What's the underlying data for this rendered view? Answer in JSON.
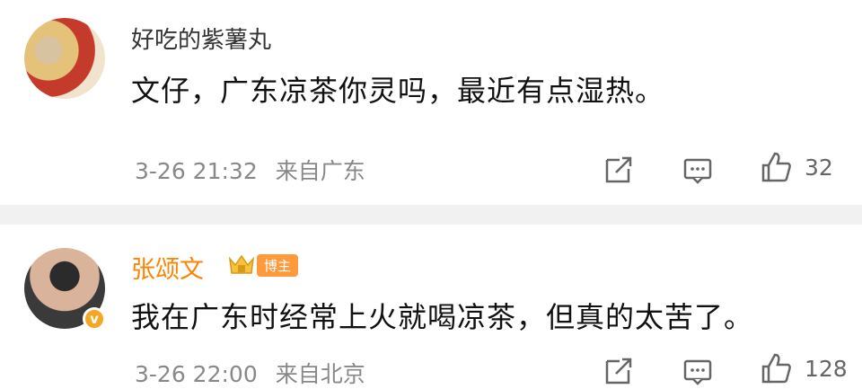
{
  "comments": [
    {
      "username": "好吃的紫薯丸",
      "text": "文仔，广东凉茶你灵吗，最近有点湿热。",
      "date": "3-26 21:32",
      "location": "来自广东",
      "likes": "32"
    },
    {
      "username": "张颂文",
      "badge_label": "博主",
      "text": "我在广东时经常上火就喝凉茶，但真的太苦了。",
      "date": "3-26 22:00",
      "location": "来自北京",
      "likes": "128",
      "verified_color": "#f5a623",
      "username_color": "#ff8200"
    }
  ]
}
